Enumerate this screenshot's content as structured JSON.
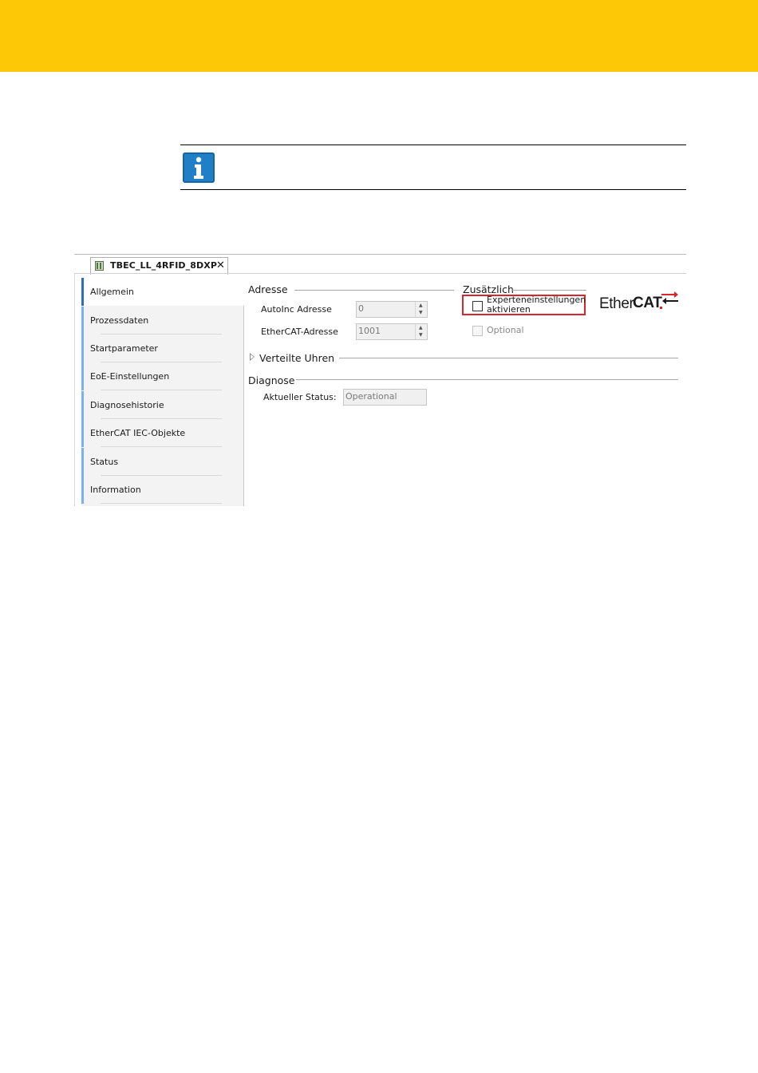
{
  "colors": {
    "band": "#fdc806",
    "info_icon": "#1f7fc7",
    "highlight": "#d9262c",
    "nav_active": "#2e6fba",
    "nav_bar": "#7ab3e6"
  },
  "editor": {
    "tab": {
      "title": "TBEC_LL_4RFID_8DXP",
      "close_symbol": "✕",
      "icon": "device-icon"
    },
    "nav": {
      "items": [
        {
          "label": "Allgemein",
          "active": true
        },
        {
          "label": "Prozessdaten"
        },
        {
          "label": "Startparameter"
        },
        {
          "label": "EoE-Einstellungen"
        },
        {
          "label": "Diagnosehistorie"
        },
        {
          "label": "EtherCAT IEC-Objekte"
        },
        {
          "label": "Status"
        },
        {
          "label": "Information"
        }
      ]
    },
    "adresse": {
      "title": "Adresse",
      "autoinc_label": "AutoInc Adresse",
      "autoinc_value": "0",
      "ethercat_label": "EtherCAT-Adresse",
      "ethercat_value": "1001"
    },
    "zusaetzlich": {
      "title": "Zusätzlich",
      "expert_line1": "Experteneinstellungen",
      "expert_line2": "aktivieren",
      "expert_checked": false,
      "optional_label": "Optional",
      "optional_checked": false,
      "optional_enabled": false
    },
    "logo": {
      "part1": "Ether",
      "part2": "CAT"
    },
    "verteilte_uhren": {
      "title": "Verteilte Uhren",
      "expanded": false
    },
    "diagnose": {
      "title": "Diagnose",
      "status_label": "Aktueller Status:",
      "status_value": "Operational"
    }
  }
}
